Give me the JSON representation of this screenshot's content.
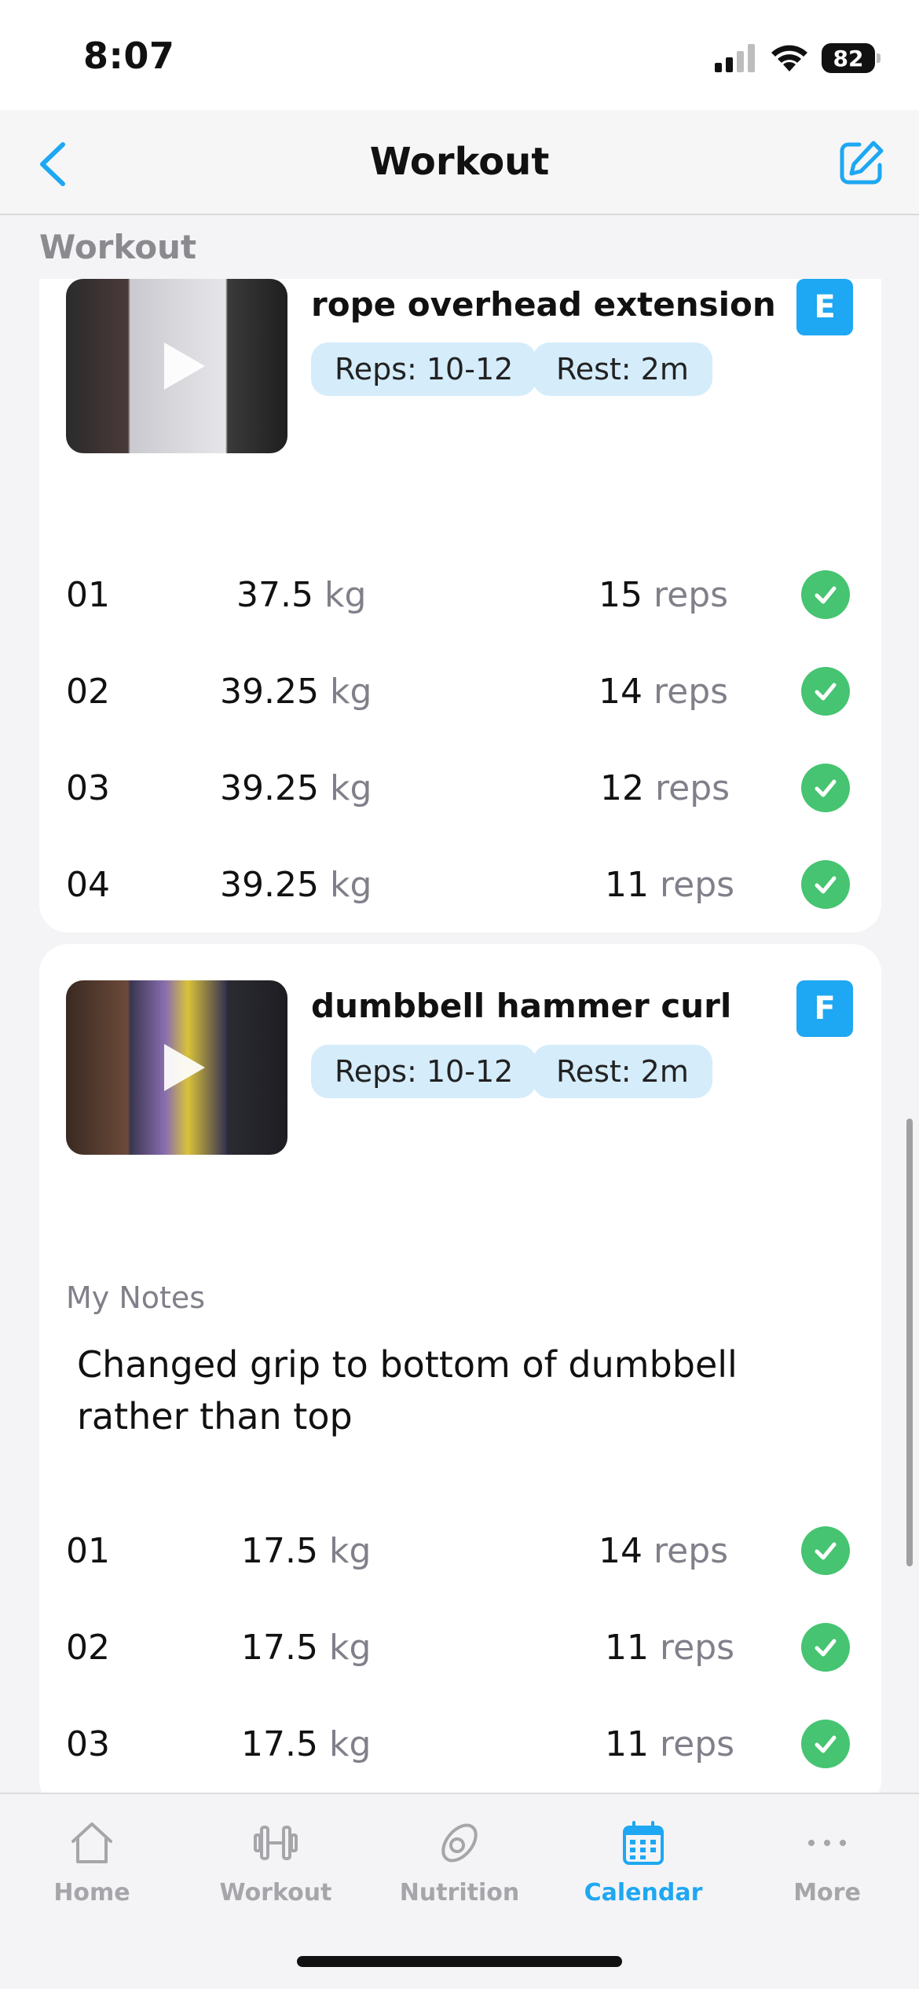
{
  "status_bar": {
    "time": "8:07",
    "battery": "82"
  },
  "nav": {
    "title": "Workout"
  },
  "section_label": "Workout",
  "colors": {
    "accent": "#1ea7f2",
    "check": "#46c471",
    "chip_bg": "#d5ecfb"
  },
  "exercises": [
    {
      "name": "rope overhead extension",
      "reps_chip": "Reps: 10-12",
      "rest_chip": "Rest: 2m",
      "badge": "E",
      "thumb_icon": "play-icon",
      "sets": [
        {
          "num": "01",
          "weight": "37.5",
          "weight_unit": "kg",
          "reps": "15",
          "reps_unit": "reps"
        },
        {
          "num": "02",
          "weight": "39.25",
          "weight_unit": "kg",
          "reps": "14",
          "reps_unit": "reps"
        },
        {
          "num": "03",
          "weight": "39.25",
          "weight_unit": "kg",
          "reps": "12",
          "reps_unit": "reps"
        },
        {
          "num": "04",
          "weight": "39.25",
          "weight_unit": "kg",
          "reps": "11",
          "reps_unit": "reps"
        }
      ]
    },
    {
      "name": "dumbbell hammer curl",
      "reps_chip": "Reps: 10-12",
      "rest_chip": "Rest: 2m",
      "badge": "F",
      "thumb_icon": "play-icon",
      "notes_label": "My Notes",
      "notes": "Changed grip to bottom of dumbbell rather than top",
      "sets": [
        {
          "num": "01",
          "weight": "17.5",
          "weight_unit": "kg",
          "reps": "14",
          "reps_unit": "reps"
        },
        {
          "num": "02",
          "weight": "17.5",
          "weight_unit": "kg",
          "reps": "11",
          "reps_unit": "reps"
        },
        {
          "num": "03",
          "weight": "17.5",
          "weight_unit": "kg",
          "reps": "11",
          "reps_unit": "reps"
        }
      ]
    }
  ],
  "tabs": [
    {
      "label": "Home",
      "icon": "home-icon"
    },
    {
      "label": "Workout",
      "icon": "dumbbell-icon"
    },
    {
      "label": "Nutrition",
      "icon": "nutrition-icon"
    },
    {
      "label": "Calendar",
      "icon": "calendar-icon",
      "active": true
    },
    {
      "label": "More",
      "icon": "more-icon"
    }
  ]
}
